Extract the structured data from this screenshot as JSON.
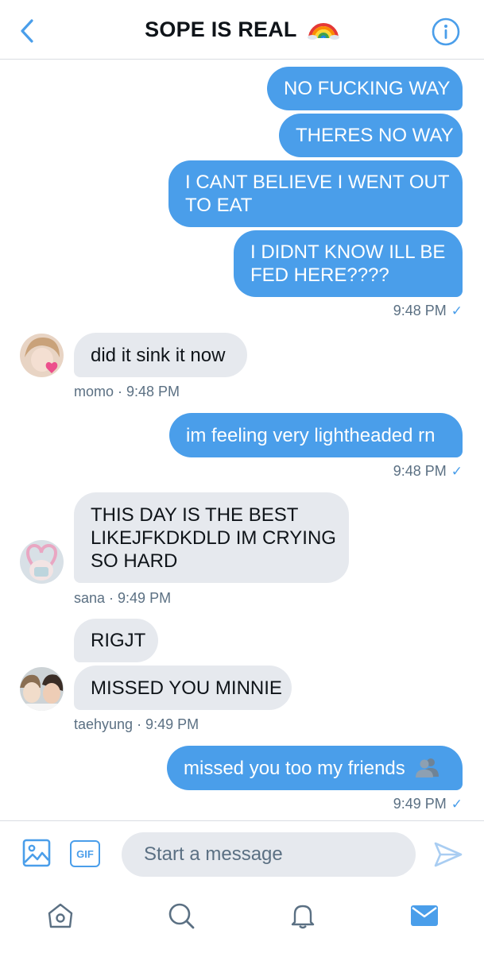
{
  "header": {
    "title": "SOPE IS REAL",
    "title_emoji": "rainbow-icon",
    "back_icon": "chevron-left-icon",
    "info_icon": "info-icon"
  },
  "colors": {
    "accent": "#4a9eea",
    "incoming_bubble": "#e6e9ee",
    "meta_text": "#5b7083"
  },
  "messages": [
    {
      "direction": "out",
      "lines": [
        "NO FUCKING WAY"
      ]
    },
    {
      "direction": "out",
      "lines": [
        "THERES NO WAY"
      ]
    },
    {
      "direction": "out",
      "lines": [
        "I CANT BELIEVE I WENT OUT",
        "TO EAT"
      ]
    },
    {
      "direction": "out",
      "lines": [
        "I DIDNT KNOW ILL BE",
        "FED HERE????"
      ]
    },
    {
      "direction": "out",
      "lines": [
        "im feeling very lightheaded rn"
      ]
    },
    {
      "direction": "in",
      "sender": "momo",
      "lines": [
        "did it sink it now"
      ]
    },
    {
      "direction": "in",
      "sender": "sana",
      "lines": [
        "THIS DAY IS THE BEST",
        "LIKEJFKDKDLD IM CRYING",
        "SO HARD"
      ]
    },
    {
      "direction": "in",
      "sender": "taehyung",
      "lines": [
        "RIGJT"
      ]
    },
    {
      "direction": "in",
      "sender": "taehyung",
      "lines": [
        "MISSED YOU MINNIE"
      ]
    },
    {
      "direction": "out",
      "lines": [
        "missed you too my friends"
      ],
      "emoji": "people-silhouette-icon"
    }
  ],
  "meta": {
    "out_1": "9:48 PM",
    "momo": "momo · 9:48 PM",
    "out_2": "9:48 PM",
    "sana": "sana · 9:49 PM",
    "taehyung": "taehyung · 9:49 PM",
    "out_3": "9:49 PM",
    "check": "✓"
  },
  "composer": {
    "placeholder": "Start a message",
    "gif_label": "GIF"
  },
  "nav": {
    "items": [
      "home-icon",
      "search-icon",
      "notifications-icon",
      "messages-icon"
    ],
    "active": "messages-icon"
  }
}
